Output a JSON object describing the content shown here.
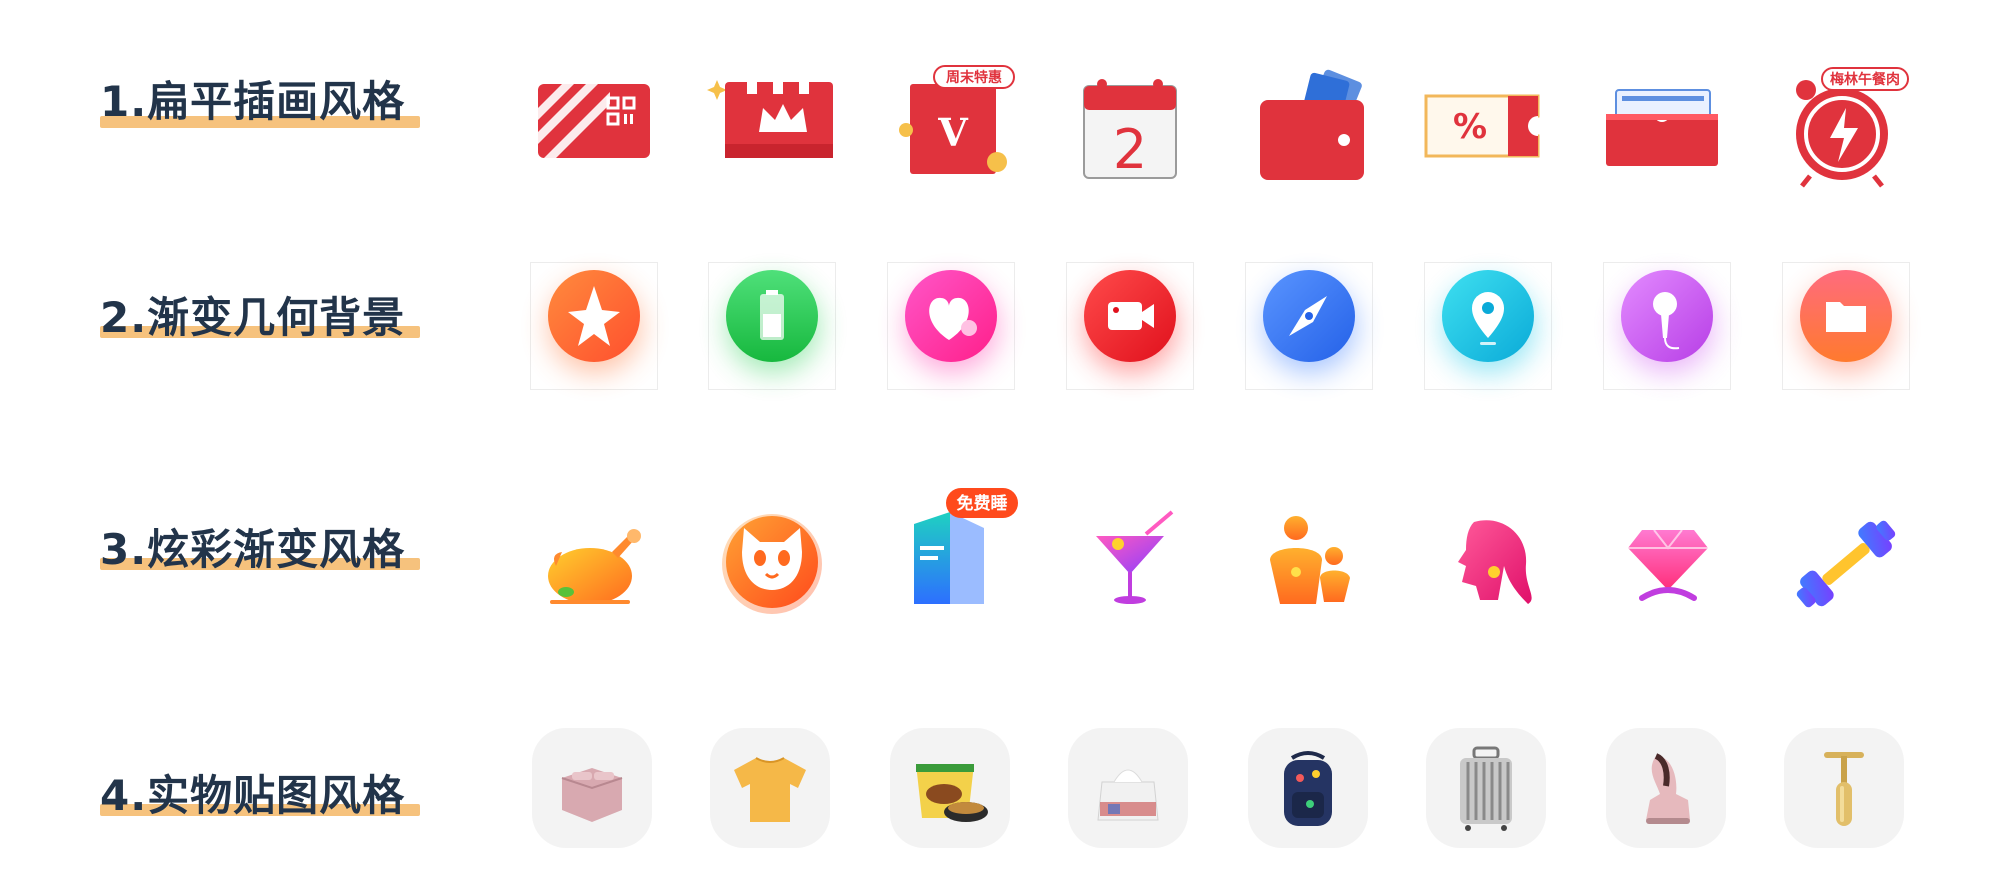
{
  "rows": [
    {
      "title": "1.扁平插画风格"
    },
    {
      "title": "2.渐变几何背景"
    },
    {
      "title": "3.炫彩渐变风格"
    },
    {
      "title": "4.实物贴图风格"
    }
  ],
  "badges": {
    "weekend_special": "周末特惠",
    "lunch_meat": "梅林午餐肉",
    "free_sleep": "免费睡",
    "calendar_day": "2",
    "vip_letter": "V",
    "coupon_percent": "%"
  },
  "colors": {
    "title": "#22344a",
    "underline": "#f6c27d",
    "flat_red": "#e0333d"
  }
}
